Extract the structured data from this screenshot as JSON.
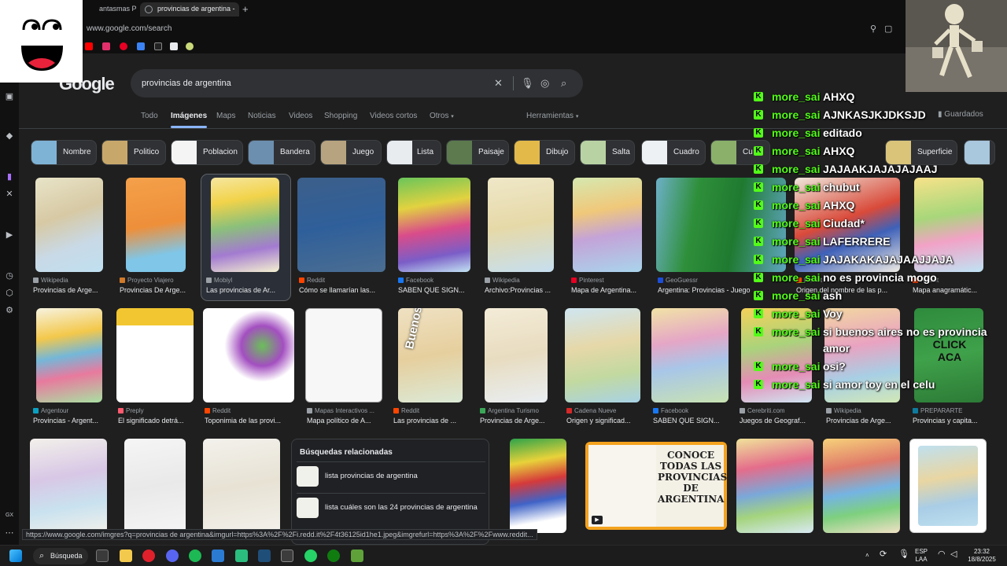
{
  "browser": {
    "tabs": [
      {
        "label": "antasmas PERTU"
      },
      {
        "label": "provincias de argentina -"
      }
    ],
    "url": "www.google.com/search",
    "status_url": "https://www.google.com/imgres?q=provincias de argentina&imgurl=https%3A%2F%2Fi.redd.it%2F4t36125id1he1.jpeg&imgrefurl=https%3A%2F%2Fwww.reddit..."
  },
  "google": {
    "logo": "Google",
    "query": "provincias de argentina",
    "tabs": [
      "Todo",
      "Imágenes",
      "Maps",
      "Noticias",
      "Videos",
      "Shopping",
      "Videos cortos",
      "Otros"
    ],
    "tools": "Herramientas",
    "saved": "Guardados",
    "chips": [
      "Nombre",
      "Politico",
      "Poblacion",
      "Bandera",
      "Juego",
      "Lista",
      "Paisaje",
      "Dibujo",
      "Salta",
      "Cuadro",
      "Cu",
      "Superficie"
    ],
    "results_row1": [
      {
        "source": "Wikipedia",
        "caption": "Provincias de Arge..."
      },
      {
        "source": "Proyecto Viajero",
        "caption": "Provincias De Arge..."
      },
      {
        "source": "Mobiyl",
        "caption": "Las provincias de Ar..."
      },
      {
        "source": "Reddit",
        "caption": "Cómo se llamarían las..."
      },
      {
        "source": "Facebook",
        "caption": "SABEN QUE SIGN..."
      },
      {
        "source": "Wikipedia",
        "caption": "Archivo:Provincias ..."
      },
      {
        "source": "Pinterest",
        "caption": "Mapa de Argentina..."
      },
      {
        "source": "GeoGuessr",
        "caption": "Argentina: Provincias - Juego"
      },
      {
        "source": "Reddit",
        "caption": "Origen del nombre de las p..."
      },
      {
        "source": "Reddit",
        "caption": "Mapa anagramátic..."
      }
    ],
    "results_row2": [
      {
        "source": "Argentour",
        "caption": "Provincias - Argent..."
      },
      {
        "source": "Preply",
        "caption": "El significado detrá..."
      },
      {
        "source": "Reddit",
        "caption": "Toponimia de las provi..."
      },
      {
        "source": "Mapas Interactivos ...",
        "caption": "Mapa político de A..."
      },
      {
        "source": "Reddit",
        "caption": "Las provincias de ..."
      },
      {
        "source": "Argentina Turismo",
        "caption": "Provincias de Arge..."
      },
      {
        "source": "Cadena Nueve",
        "caption": "Origen y significad..."
      },
      {
        "source": "Facebook",
        "caption": "SABEN QUE SIGN..."
      },
      {
        "source": "Cerebriti.com",
        "caption": "Juegos de Geograf..."
      },
      {
        "source": "Wikipedia",
        "caption": "Provincias de Arge..."
      },
      {
        "source": "PREPARARTE",
        "caption": "Provincias y capita..."
      }
    ],
    "image_texts": {
      "conoce": "CONOCE TODAS LAS PROVINCIAS DE ARGENTINA",
      "click": "CLICK ACA",
      "buenos": "Buenos Aires"
    },
    "related": {
      "title": "Búsquedas relacionadas",
      "items": [
        "lista provincias de argentina",
        "lista cuáles son las 24 provincias de argentina"
      ]
    }
  },
  "chat": [
    {
      "user": "more_sai",
      "text": "AHXQ"
    },
    {
      "user": "more_sai",
      "text": "AJNKASJKJDKSJD"
    },
    {
      "user": "more_sai",
      "text": "editado"
    },
    {
      "user": "more_sai",
      "text": "AHXQ"
    },
    {
      "user": "more_sai",
      "text": "JAJAAKJAJAJAJAAJ"
    },
    {
      "user": "more_sai",
      "text": "chubut"
    },
    {
      "user": "more_sai",
      "text": "AHXQ"
    },
    {
      "user": "more_sai",
      "text": "Ciudad*"
    },
    {
      "user": "more_sai",
      "text": "LAFERRERE"
    },
    {
      "user": "more_sai",
      "text": "JAJAKAKAJAJAAJJAJA"
    },
    {
      "user": "more_sai",
      "text": "no es provincia mogo"
    },
    {
      "user": "more_sai",
      "text": "ash"
    },
    {
      "user": "more_sai",
      "text": "Voy"
    },
    {
      "user": "more_sai",
      "text": "si buenos aires no es provincia"
    },
    {
      "user": "more_sai",
      "text": "amor"
    },
    {
      "user": "more_sai",
      "text": "osi?"
    },
    {
      "user": "more_sai",
      "text": "si amor toy en el celu"
    }
  ],
  "taskbar": {
    "search": "Búsqueda",
    "lang": "ESP",
    "lang2": "LAA",
    "time": "23:32",
    "date": "18/8/2025"
  },
  "colors": {
    "accent": "#8ab4f8",
    "kick": "#53fc18"
  }
}
